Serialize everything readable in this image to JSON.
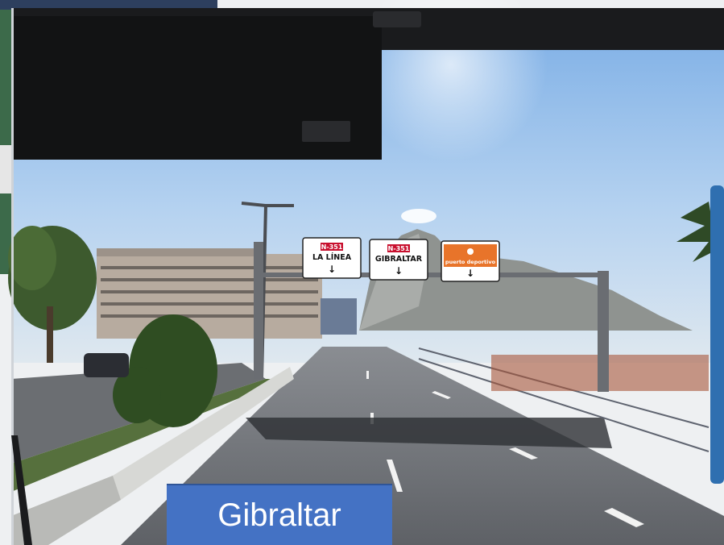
{
  "caption": "Gibraltar",
  "signs": [
    {
      "route": "N-351",
      "destination": "LA LÍNEA",
      "arrow": "↓"
    },
    {
      "route": "N-351",
      "destination": "GIBRALTAR",
      "arrow": "↓"
    },
    {
      "route": "",
      "destination": "puerto deportivo",
      "arrow": "↓"
    }
  ],
  "colors": {
    "caption_bg": "#4472c4",
    "sky": "#a9c9ec",
    "sign_red": "#c8102e",
    "sign_orange": "#e8742a"
  }
}
